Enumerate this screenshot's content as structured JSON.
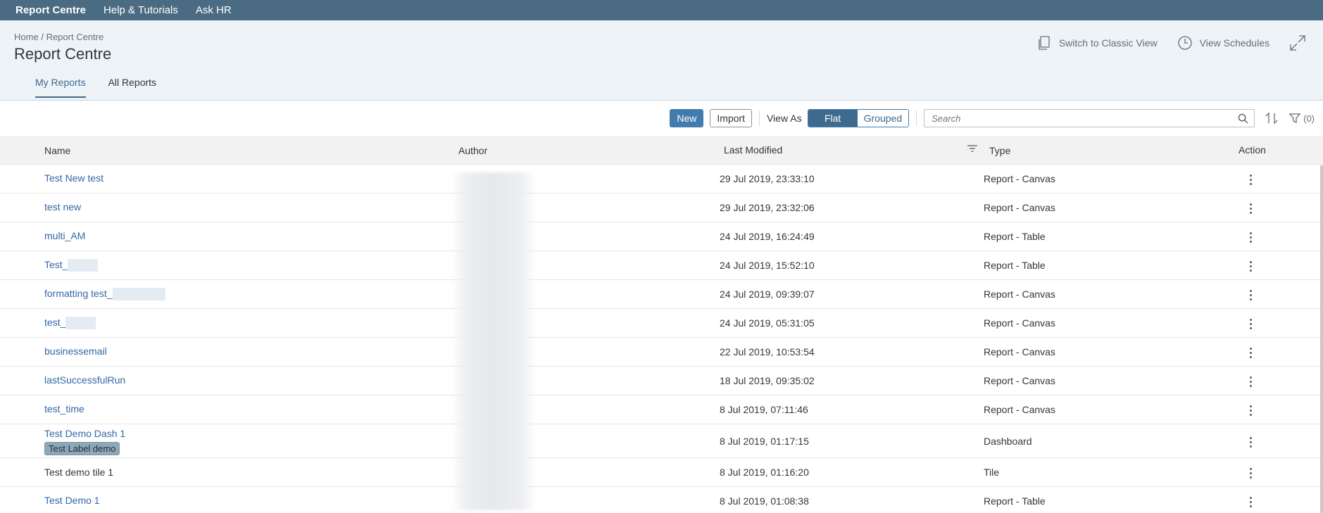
{
  "topnav": {
    "items": [
      {
        "label": "Report Centre",
        "active": true
      },
      {
        "label": "Help & Tutorials"
      },
      {
        "label": "Ask HR"
      }
    ]
  },
  "header": {
    "breadcrumb_home": "Home",
    "breadcrumb_sep": "/",
    "breadcrumb_current": "Report Centre",
    "title": "Report Centre",
    "switch_classic_label": "Switch to Classic View",
    "view_schedules_label": "View Schedules"
  },
  "tabs": [
    {
      "label": "My Reports",
      "active": true
    },
    {
      "label": "All Reports"
    }
  ],
  "toolbar": {
    "new_label": "New",
    "import_label": "Import",
    "view_as_label": "View As",
    "flat_label": "Flat",
    "grouped_label": "Grouped",
    "search_placeholder": "Search",
    "filter_count": "(0)"
  },
  "table": {
    "columns": {
      "name": "Name",
      "author": "Author",
      "last_modified": "Last Modified",
      "type": "Type",
      "action": "Action"
    },
    "rows": [
      {
        "name": "Test New test",
        "date": "29 Jul 2019, 23:33:10",
        "type": "Report - Canvas"
      },
      {
        "name": "test new",
        "date": "29 Jul 2019, 23:32:06",
        "type": "Report - Canvas"
      },
      {
        "name": "multi_AM",
        "date": "24 Jul 2019, 16:24:49",
        "type": "Report - Table"
      },
      {
        "name": "Test_",
        "date": "24 Jul 2019, 15:52:10",
        "type": "Report - Table"
      },
      {
        "name": "formatting test_",
        "date": "24 Jul 2019, 09:39:07",
        "type": "Report - Canvas"
      },
      {
        "name": "test_",
        "date": "24 Jul 2019, 05:31:05",
        "type": "Report - Canvas"
      },
      {
        "name": "businessemail",
        "date": "22 Jul 2019, 10:53:54",
        "type": "Report - Canvas"
      },
      {
        "name": "lastSuccessfulRun",
        "date": "18 Jul 2019, 09:35:02",
        "type": "Report - Canvas"
      },
      {
        "name": "test_time",
        "date": "8 Jul 2019, 07:11:46",
        "type": "Report - Canvas"
      },
      {
        "name": "Test Demo Dash 1",
        "label": "Test Label demo",
        "date": "8 Jul 2019, 01:17:15",
        "type": "Dashboard"
      },
      {
        "name": "Test demo tile 1",
        "date": "8 Jul 2019, 01:16:20",
        "type": "Tile"
      },
      {
        "name": "Test Demo 1",
        "date": "8 Jul 2019, 01:08:38",
        "type": "Report - Table"
      }
    ]
  },
  "colors": {
    "topnav_bg": "#4a6b82",
    "header_bg": "#eef3f8",
    "accent": "#3d6a8e",
    "link": "#3068a8",
    "primary_button": "#427cac"
  },
  "icons": [
    "copy-icon",
    "clock-icon",
    "expand-icon",
    "search-icon",
    "sort-icon",
    "filter-icon",
    "column-filter-icon",
    "more-vertical-icon"
  ]
}
